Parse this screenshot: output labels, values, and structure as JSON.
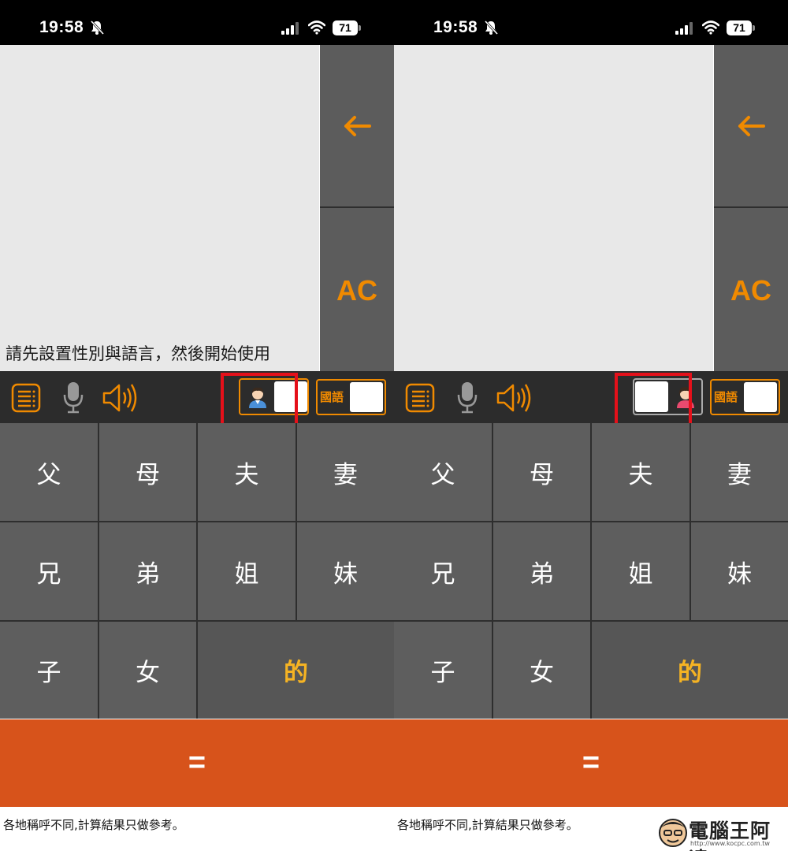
{
  "status_bar": {
    "time": "19:58",
    "battery": "71"
  },
  "screens": [
    {
      "display_hint": "請先設置性別與語言，然後開始使用",
      "ac_label": "AC",
      "gender_selected": "male",
      "language_label": "國語"
    },
    {
      "display_hint": "",
      "ac_label": "AC",
      "gender_selected": "female",
      "language_label": "國語"
    }
  ],
  "keys": {
    "row1": [
      "父",
      "母",
      "夫",
      "妻"
    ],
    "row2": [
      "兄",
      "弟",
      "姐",
      "妹"
    ],
    "row3": [
      "子",
      "女"
    ],
    "de": "的",
    "equals": "="
  },
  "footer_note": "各地稱呼不同,計算結果只做參考。",
  "watermark": {
    "name": "電腦王阿達",
    "url": "http://www.kocpc.com.tw"
  },
  "colors": {
    "accent": "#f08a00",
    "equals_bg": "#d7531b",
    "highlight": "#e5101a",
    "key_bg": "#5e5e5e",
    "de_text": "#f5b323"
  }
}
